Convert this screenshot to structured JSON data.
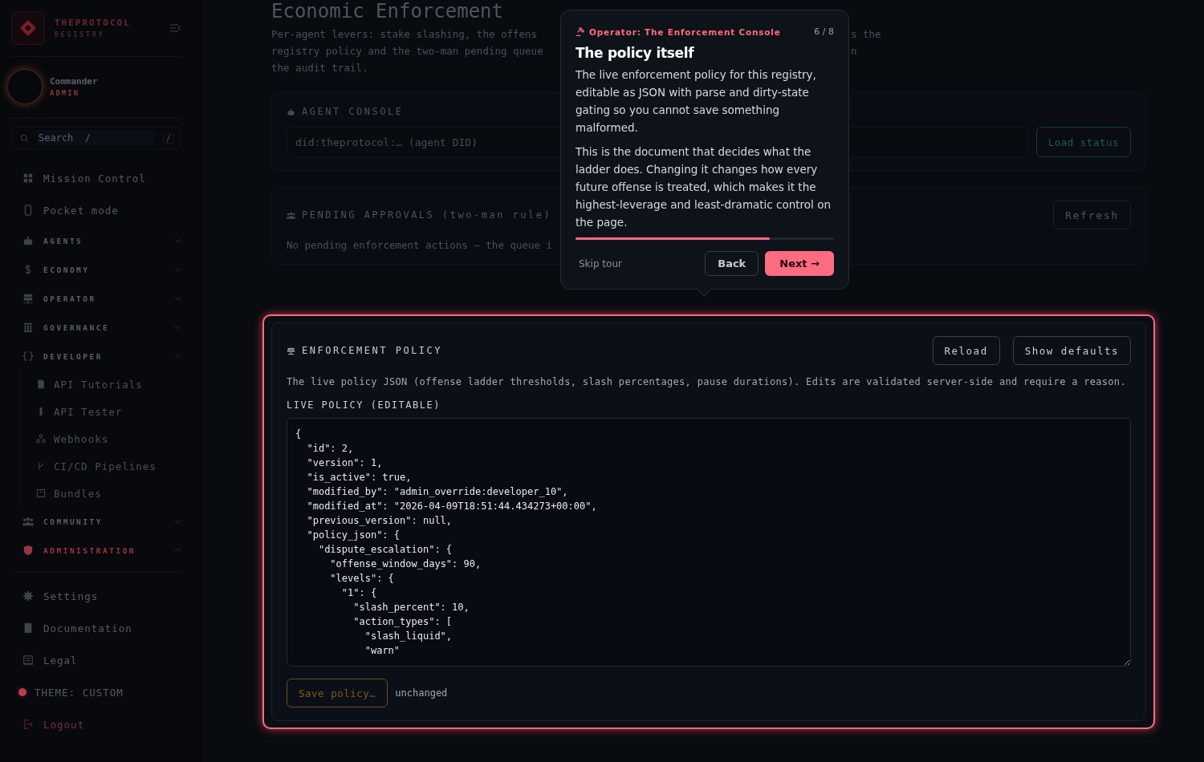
{
  "brand": {
    "name": "THEPROTOCOL",
    "subtitle": "REGISTRY"
  },
  "user": {
    "name": "Commander",
    "role": "ADMIN"
  },
  "search": {
    "placeholder": "Search  /",
    "shortcut": "/"
  },
  "nav": [
    {
      "kind": "link",
      "label": "Mission Control"
    },
    {
      "kind": "link",
      "label": "Pocket mode"
    },
    {
      "kind": "section",
      "label": "AGENTS",
      "expanded": false,
      "active": false
    },
    {
      "kind": "section",
      "label": "ECONOMY",
      "expanded": false,
      "active": false
    },
    {
      "kind": "section",
      "label": "OPERATOR",
      "expanded": false,
      "active": false
    },
    {
      "kind": "section",
      "label": "GOVERNANCE",
      "expanded": false,
      "active": false
    },
    {
      "kind": "section",
      "label": "DEVELOPER",
      "expanded": true,
      "active": false,
      "children": [
        {
          "label": "API Tutorials"
        },
        {
          "label": "API Tester"
        },
        {
          "label": "Webhooks"
        },
        {
          "label": "CI/CD Pipelines"
        },
        {
          "label": "Bundles"
        }
      ]
    },
    {
      "kind": "section",
      "label": "COMMUNITY",
      "expanded": false,
      "active": false
    },
    {
      "kind": "section",
      "label": "ADMINISTRATION",
      "expanded": true,
      "active": true
    }
  ],
  "footer_nav": [
    {
      "kind": "link",
      "label": "Settings"
    },
    {
      "kind": "link",
      "label": "Documentation"
    },
    {
      "kind": "link",
      "label": "Legal"
    },
    {
      "kind": "theme",
      "label": "THEME: CUSTOM",
      "color": "#c0394b"
    },
    {
      "kind": "logout",
      "label": "Logout"
    }
  ],
  "page": {
    "title": "Economic Enforcement",
    "intro_left": [
      "Per-agent levers: stake slashing, the offens",
      "registry policy and the two-man pending queue",
      "the audit trail."
    ],
    "intro_right": [
      "s the",
      "n"
    ]
  },
  "agent_console": {
    "title": "AGENT CONSOLE",
    "placeholder": "did:theprotocol:… (agent DID)",
    "button": "Load status"
  },
  "pending": {
    "title": "PENDING APPROVALS (two-man rule)",
    "button": "Refresh",
    "empty": "No pending enforcement actions — the queue i"
  },
  "policy": {
    "title": "ENFORCEMENT POLICY",
    "buttons": [
      "Reload",
      "Show defaults"
    ],
    "description": "The live policy JSON (offense ladder thresholds, slash percentages, pause durations). Edits are validated server-side and require a reason.",
    "field_label": "LIVE POLICY (EDITABLE)",
    "lines": [
      "{",
      "  \"id\": 2,",
      "  \"version\": 1,",
      "  \"is_active\": true,",
      "  \"modified_by\": \"admin_override:developer_10\",",
      "  \"modified_at\": \"2026-04-09T18:51:44.434273+00:00\",",
      "  \"previous_version\": null,",
      "  \"policy_json\": {",
      "    \"dispute_escalation\": {",
      "      \"offense_window_days\": 90,",
      "      \"levels\": {",
      "        \"1\": {",
      "          \"slash_percent\": 10,",
      "          \"action_types\": [",
      "            \"slash_liquid\",",
      "            \"warn\""
    ],
    "save_button": "Save policy…",
    "save_disabled": true,
    "status": "unchanged"
  },
  "tour": {
    "eyebrow": "Operator: The Enforcement Console",
    "step": "6 / 8",
    "title": "The policy itself",
    "paragraphs": [
      "The live enforcement policy for this registry, editable as JSON with parse and dirty-state gating so you cannot save something malformed.",
      "This is the document that decides what the ladder does. Changing it changes how every future offense is treated, which makes it the highest-leverage and least-dramatic control on the page."
    ],
    "level": 0.75,
    "skip": "Skip tour",
    "back": "Back",
    "next": "Next →"
  }
}
